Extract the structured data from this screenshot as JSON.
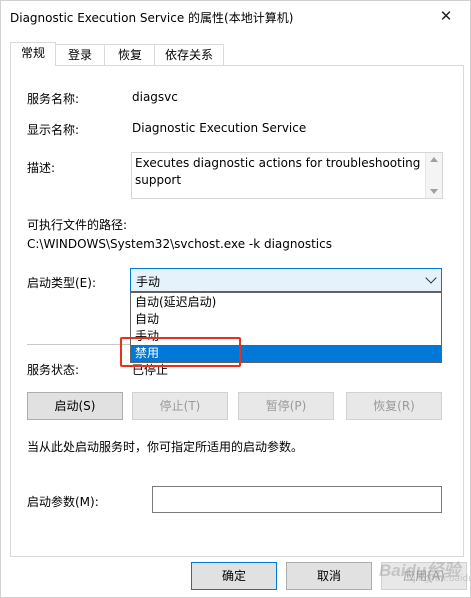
{
  "window": {
    "title": "Diagnostic Execution Service 的属性(本地计算机)",
    "close_glyph": "✕"
  },
  "tabs": [
    {
      "label": "常规",
      "active": true
    },
    {
      "label": "登录",
      "active": false
    },
    {
      "label": "恢复",
      "active": false
    },
    {
      "label": "依存关系",
      "active": false
    }
  ],
  "general": {
    "service_name_label": "服务名称:",
    "service_name_value": "diagsvc",
    "display_name_label": "显示名称:",
    "display_name_value": "Diagnostic Execution Service",
    "description_label": "描述:",
    "description_value": "Executes diagnostic actions for troubleshooting support",
    "exe_path_label": "可执行文件的路径:",
    "exe_path_value": "C:\\WINDOWS\\System32\\svchost.exe -k diagnostics",
    "startup_type_label": "启动类型(E):",
    "startup_type_value": "手动",
    "startup_options": [
      {
        "label": "自动(延迟启动)",
        "selected": false
      },
      {
        "label": "自动",
        "selected": false
      },
      {
        "label": "手动",
        "selected": false
      },
      {
        "label": "禁用",
        "selected": true
      }
    ],
    "service_status_label": "服务状态:",
    "service_status_value": "已停止",
    "buttons": {
      "start": "启动(S)",
      "stop": "停止(T)",
      "pause": "暂停(P)",
      "resume": "恢复(R)"
    },
    "hint_text": "当从此处启动服务时，你可指定所适用的启动参数。",
    "start_params_label": "启动参数(M):",
    "start_params_value": ""
  },
  "footer": {
    "ok": "确定",
    "cancel": "取消",
    "apply": "应用(A)"
  },
  "watermark": {
    "text": "Baidu经验",
    "sub": "jingyan.baidu.com"
  },
  "colors": {
    "accent": "#0078d7",
    "highlight_box": "#e8311a",
    "combo_bg": "#e5f1fb"
  }
}
